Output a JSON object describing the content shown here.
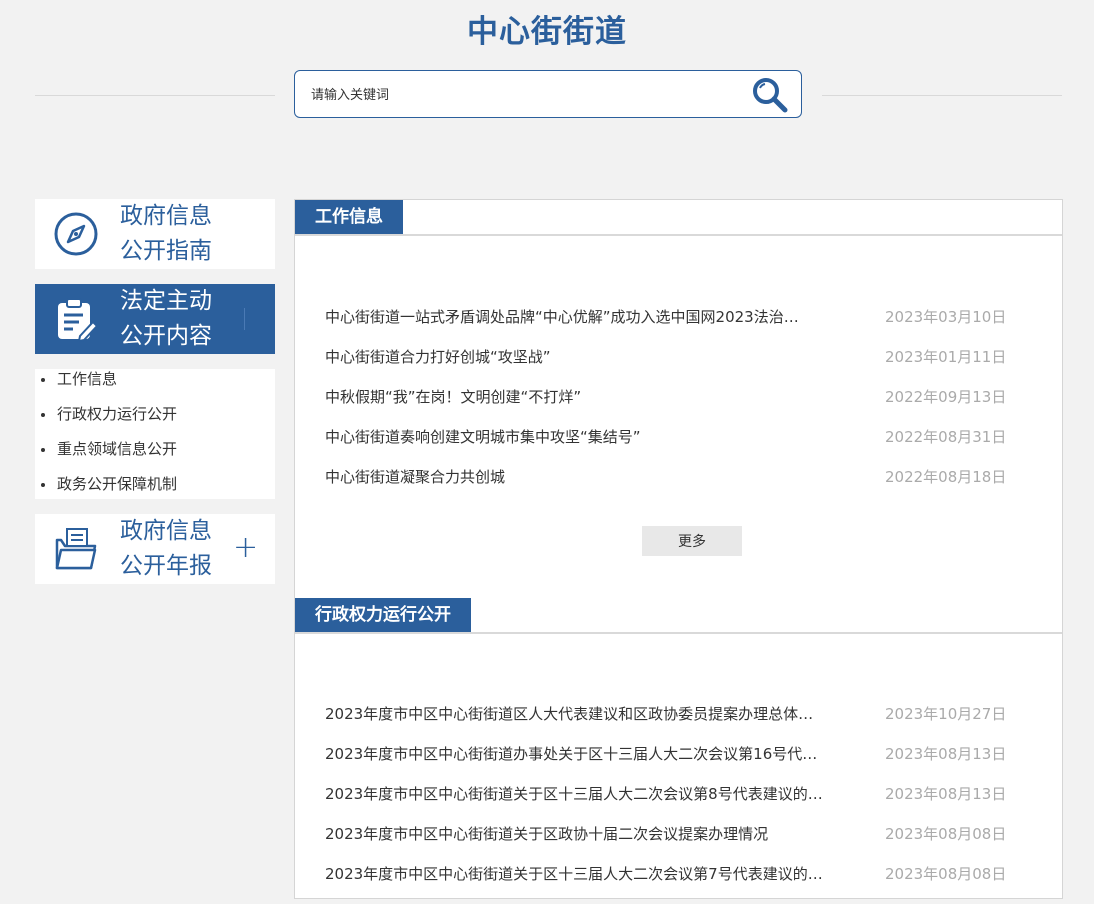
{
  "header": {
    "site_title": "中心街街道",
    "search": {
      "placeholder": "请输入关键词",
      "value": ""
    }
  },
  "sidebar": {
    "cards": [
      {
        "line1": "政府信息",
        "line2": "公开指南",
        "icon": "compass-icon"
      },
      {
        "line1": "法定主动",
        "line2": "公开内容",
        "icon": "clipboard-edit-icon"
      },
      {
        "line1": "政府信息",
        "line2": "公开年报",
        "icon": "folder-document-icon",
        "toggle": "+"
      }
    ],
    "sub_items": [
      "工作信息",
      "行政权力运行公开",
      "重点领域信息公开",
      "政务公开保障机制"
    ]
  },
  "sections": [
    {
      "title": "工作信息",
      "items": [
        {
          "title": "中心街街道一站式矛盾调处品牌“中心优解”成功入选中国网2023法治…",
          "date": "2023年03月10日"
        },
        {
          "title": "中心街街道合力打好创城“攻坚战”",
          "date": "2023年01月11日"
        },
        {
          "title": "中秋假期“我”在岗！文明创建“不打烊”",
          "date": "2022年09月13日"
        },
        {
          "title": "中心街街道奏响创建文明城市集中攻坚“集结号”",
          "date": "2022年08月31日"
        },
        {
          "title": "中心街街道凝聚合力共创城",
          "date": "2022年08月18日"
        }
      ],
      "more_label": "更多"
    },
    {
      "title": "行政权力运行公开",
      "items": [
        {
          "title": "2023年度市中区中心街街道区人大代表建议和区政协委员提案办理总体…",
          "date": "2023年10月27日"
        },
        {
          "title": "2023年度市中区中心街街道办事处关于区十三届人大二次会议第16号代…",
          "date": "2023年08月13日"
        },
        {
          "title": "2023年度市中区中心街街道关于区十三届人大二次会议第8号代表建议的…",
          "date": "2023年08月13日"
        },
        {
          "title": "2023年度市中区中心街街道关于区政协十届二次会议提案办理情况",
          "date": "2023年08月08日"
        },
        {
          "title": "2023年度市中区中心街街道关于区十三届人大二次会议第7号代表建议的…",
          "date": "2023年08月08日"
        }
      ]
    }
  ],
  "colors": {
    "accent": "#2b5f9c",
    "date": "#aaaaaa",
    "background": "#f2f2f2"
  }
}
